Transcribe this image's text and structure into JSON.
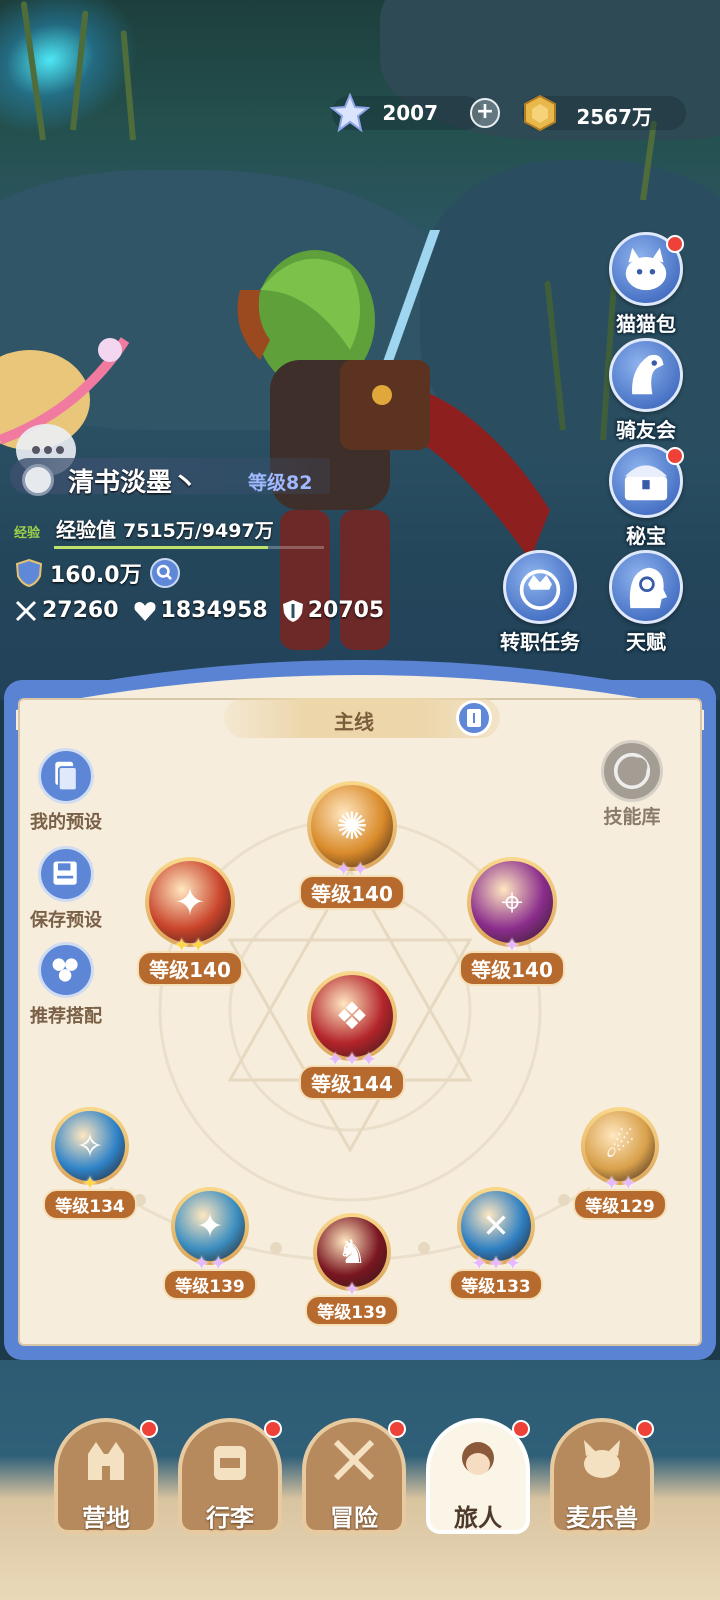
{
  "currency": {
    "diamond_value": "2007",
    "diamond_icon": "crystal-star-icon",
    "add_label": "+",
    "gold_value": "2567万",
    "gold_icon": "gold-coin-icon"
  },
  "right_menu": [
    {
      "label": "猫猫包",
      "icon": "cat-bag-icon",
      "badge": true
    },
    {
      "label": "骑友会",
      "icon": "horse-head-icon",
      "badge": false
    },
    {
      "label": "秘宝",
      "icon": "treasure-chest-icon",
      "badge": true
    },
    {
      "label": "转职任务",
      "icon": "crown-emblem-icon",
      "badge": false
    },
    {
      "label": "天赋",
      "icon": "head-gear-icon",
      "badge": false
    }
  ],
  "player": {
    "name": "清书淡墨丶",
    "level": "等级82",
    "exp_tag": "经验",
    "exp_label": "经验值",
    "exp_value": "7515万/9497万",
    "exp_fraction": 0.791,
    "power": "160.0万",
    "attack": "27260",
    "hp": "1834958",
    "defense": "20705"
  },
  "panel": {
    "tab_label": "主线",
    "side_buttons": [
      {
        "label": "我的预设",
        "icon": "preset-cards-icon"
      },
      {
        "label": "保存预设",
        "icon": "save-disk-icon"
      },
      {
        "label": "推荐搭配",
        "icon": "recommend-icon"
      }
    ],
    "skill_library": "技能库",
    "skills": [
      {
        "id": "top",
        "level": "等级140",
        "stars": 2,
        "star_color": "purple",
        "color": "#d98a2a",
        "glyph": "✺"
      },
      {
        "id": "left",
        "level": "等级140",
        "stars": 2,
        "star_color": "gold",
        "color": "#c9442b",
        "glyph": "✦"
      },
      {
        "id": "right",
        "level": "等级140",
        "stars": 1,
        "star_color": "purple",
        "color": "#8a2d8c",
        "glyph": "⌖"
      },
      {
        "id": "center",
        "level": "等级144",
        "stars": 3,
        "star_color": "purple",
        "color": "#b3242a",
        "glyph": "❖"
      },
      {
        "id": "b1",
        "level": "等级134",
        "stars": 1,
        "star_color": "gold",
        "color": "#2f83c8",
        "glyph": "✧"
      },
      {
        "id": "b2",
        "level": "等级139",
        "stars": 2,
        "star_color": "purple",
        "color": "#3c8ec0",
        "glyph": "✦"
      },
      {
        "id": "b3",
        "level": "等级139",
        "stars": 1,
        "star_color": "purple",
        "color": "#7a1620",
        "glyph": "♞"
      },
      {
        "id": "b4",
        "level": "等级133",
        "stars": 3,
        "star_color": "purple",
        "color": "#2e7fc2",
        "glyph": "✕"
      },
      {
        "id": "b5",
        "level": "等级129",
        "stars": 2,
        "star_color": "purple",
        "color": "#d8a04a",
        "glyph": "☄"
      }
    ]
  },
  "bottom_nav": [
    {
      "label": "营地",
      "icon": "castle-icon",
      "badge": true,
      "active": false
    },
    {
      "label": "行李",
      "icon": "backpack-icon",
      "badge": true,
      "active": false
    },
    {
      "label": "冒险",
      "icon": "crossed-swords-icon",
      "badge": true,
      "active": false
    },
    {
      "label": "旅人",
      "icon": "traveler-portrait-icon",
      "badge": true,
      "active": true
    },
    {
      "label": "麦乐兽",
      "icon": "pet-cat-icon",
      "badge": true,
      "active": false
    }
  ]
}
